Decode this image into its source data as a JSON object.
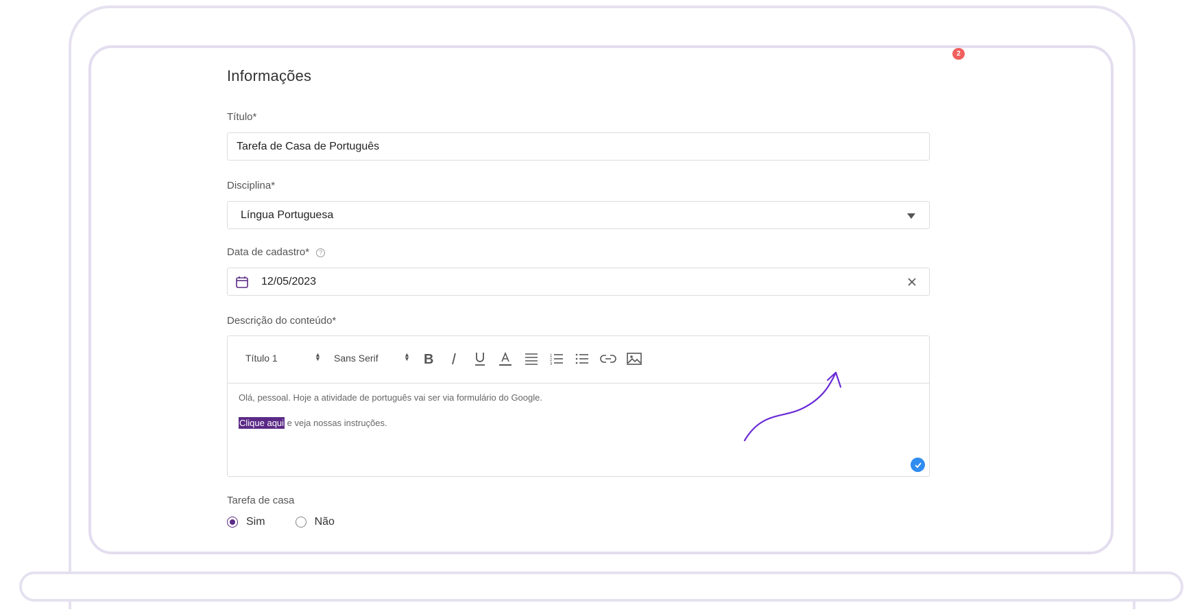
{
  "notification_count": "2",
  "form": {
    "section_title": "Informações",
    "titulo": {
      "label": "Título*",
      "value": "Tarefa de Casa de Português"
    },
    "disciplina": {
      "label": "Disciplina*",
      "value": "Língua Portuguesa"
    },
    "data_cadastro": {
      "label": "Data de cadastro*",
      "help": "?",
      "value": "12/05/2023"
    },
    "descricao": {
      "label": "Descrição do conteúdo*",
      "toolbar": {
        "heading_select": "Título 1",
        "font_select": "Sans Serif",
        "buttons": [
          "bold",
          "italic",
          "underline",
          "text-color",
          "align",
          "ordered-list",
          "bullet-list",
          "link",
          "image"
        ]
      },
      "line1": "Olá, pessoal. Hoje a atividade de português vai ser via formulário do Google.",
      "line2_highlight": "Clique aqui",
      "line2_rest": " e veja nossas instruções."
    },
    "tarefa_casa": {
      "label": "Tarefa de casa",
      "option_yes": "Sim",
      "option_no": "Não",
      "selected": "Sim"
    }
  },
  "colors": {
    "accent": "#5b2a86",
    "badge": "#f0605d",
    "check": "#2f8cf0",
    "frame": "#e6e1f0"
  }
}
